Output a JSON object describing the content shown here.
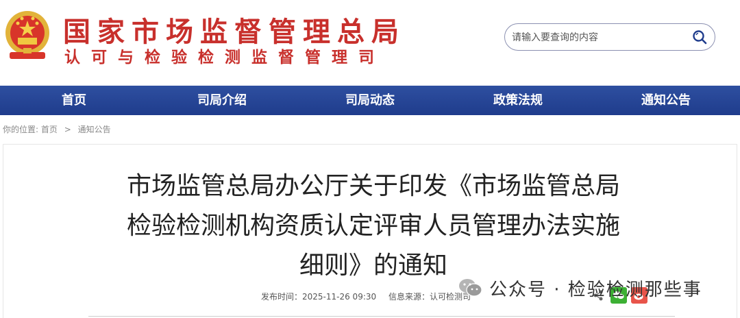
{
  "header": {
    "title_main": "国家市场监督管理总局",
    "title_sub": "认可与检验检测监督管理司",
    "emblem_icon": "national-emblem-icon",
    "search_placeholder": "请输入要查询的内容",
    "search_icon": "search-icon"
  },
  "nav": {
    "items": [
      "首页",
      "司局介绍",
      "司局动态",
      "政策法规",
      "通知公告"
    ]
  },
  "breadcrumb": {
    "prefix": "你的位置:",
    "home": "首页",
    "separator": ">",
    "current": "通知公告"
  },
  "article": {
    "title_line1": "市场监管总局办公厅关于印发《市场监管总局",
    "title_line2": "检验检测机构资质认定评审人员管理办法实施",
    "title_line3": "细则》的通知",
    "publish_time": "发布时间：2025-11-26 09:30",
    "source": "信息来源：认可检测司"
  },
  "watermark": {
    "text": "公众号 · 检验检测那些事"
  },
  "colors": {
    "brand_red": "#c8302c",
    "nav_blue": "#1f3c8c",
    "wechat_green": "#3cb034",
    "weibo_red": "#e8544a"
  }
}
